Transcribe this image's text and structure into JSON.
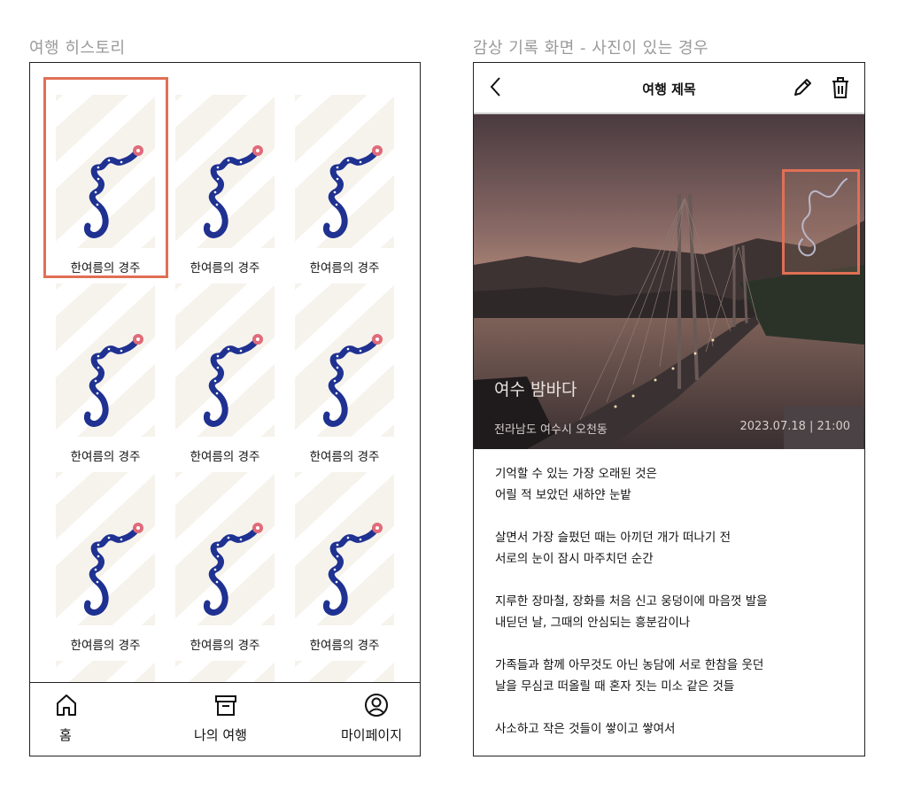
{
  "left_section_title": "여행 히스토리",
  "right_section_title": "감상 기록 화면 - 사진이 있는 경우",
  "history_items": [
    {
      "label": "한여름의 경주"
    },
    {
      "label": "한여름의 경주"
    },
    {
      "label": "한여름의 경주"
    },
    {
      "label": "한여름의 경주"
    },
    {
      "label": "한여름의 경주"
    },
    {
      "label": "한여름의 경주"
    },
    {
      "label": "한여름의 경주"
    },
    {
      "label": "한여름의 경주"
    },
    {
      "label": "한여름의 경주"
    }
  ],
  "nav": {
    "home": {
      "label": "홈",
      "icon": "home-icon"
    },
    "my_trips": {
      "label": "나의 여행",
      "icon": "archive-icon"
    },
    "my_page": {
      "label": "마이페이지",
      "icon": "user-icon"
    }
  },
  "detail": {
    "title": "여행 제목",
    "photo_caption": "여수 밤바다",
    "location": "전라남도 여수시 오천동",
    "datetime": "2023.07.18 | 21:00",
    "paragraphs": [
      [
        "기억할 수 있는 가장 오래된 것은",
        "어릴 적 보았던 새하얀 눈밭"
      ],
      [
        "살면서 가장 슬펐던 때는 아끼던 개가 떠나기 전",
        "서로의 눈이 잠시 마주치던 순간"
      ],
      [
        "지루한 장마철, 장화를 처음 신고 웅덩이에 마음껏 발을",
        "내딛던 날, 그때의 안심되는 흥분감이나"
      ],
      [
        "가족들과 함께 아무것도 아닌 농담에 서로 한참을 웃던",
        "날을 무심코 떠올릴 때 혼자 짓는 미소 같은 것들"
      ],
      [
        "사소하고 작은 것들이 쌓이고 쌓여서"
      ]
    ]
  },
  "colors": {
    "accent_border": "#e07055",
    "route": "#1f3191",
    "route_end": "#e06b7a",
    "map_bg": "#f6f3ec"
  }
}
